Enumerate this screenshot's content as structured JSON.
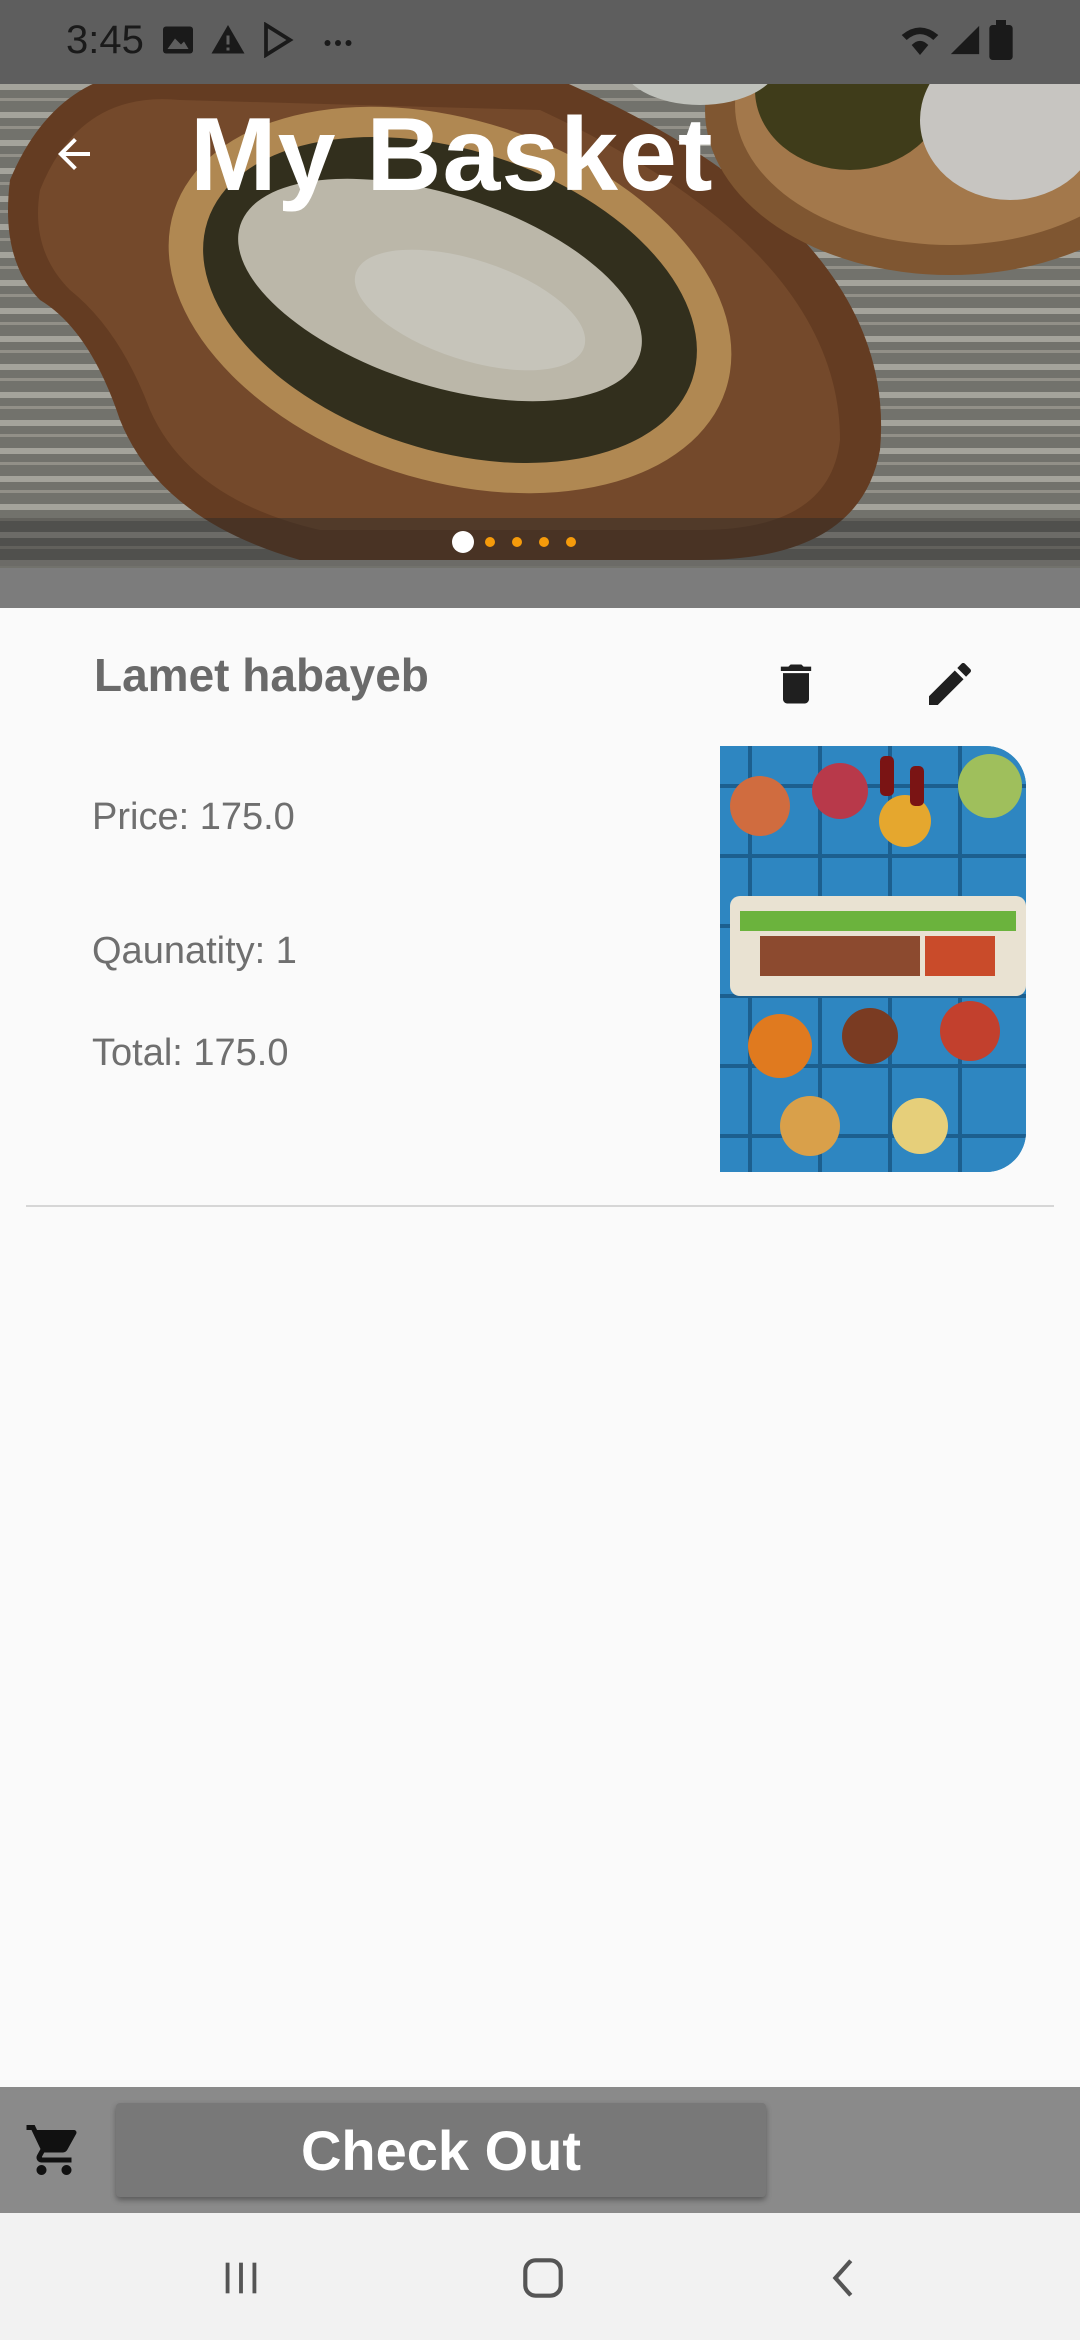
{
  "status_bar": {
    "time": "3:45",
    "left_icons": [
      "image-icon",
      "warning-icon",
      "play-store-icon",
      "more-dots-icon"
    ],
    "right_icons": [
      "wifi-icon",
      "signal-icon",
      "battery-icon"
    ]
  },
  "header": {
    "title": "My Basket",
    "back_icon": "arrow-back-icon",
    "carousel": {
      "slides": 5,
      "active_index": 0,
      "active_color": "#ffffff",
      "inactive_color": "#f59b0b"
    }
  },
  "basket_item": {
    "name": "Lamet habayeb",
    "price_text": "Price: 175.0",
    "quantity_text": "Qaunatity: 1",
    "total_text": "Total: 175.0",
    "delete_icon": "trash-icon",
    "edit_icon": "pencil-icon",
    "image_icon": "food-spread-image"
  },
  "bottom_bar": {
    "cart_icon": "shopping-cart-icon",
    "checkout_label": "Check Out"
  },
  "system_nav": [
    "recents-icon",
    "home-icon",
    "back-icon"
  ],
  "colors": {
    "background": "#fafafa",
    "bottom_bar": "#8a8a8a",
    "checkout_button": "#787878",
    "carousel_dot": "#f59b0b"
  }
}
